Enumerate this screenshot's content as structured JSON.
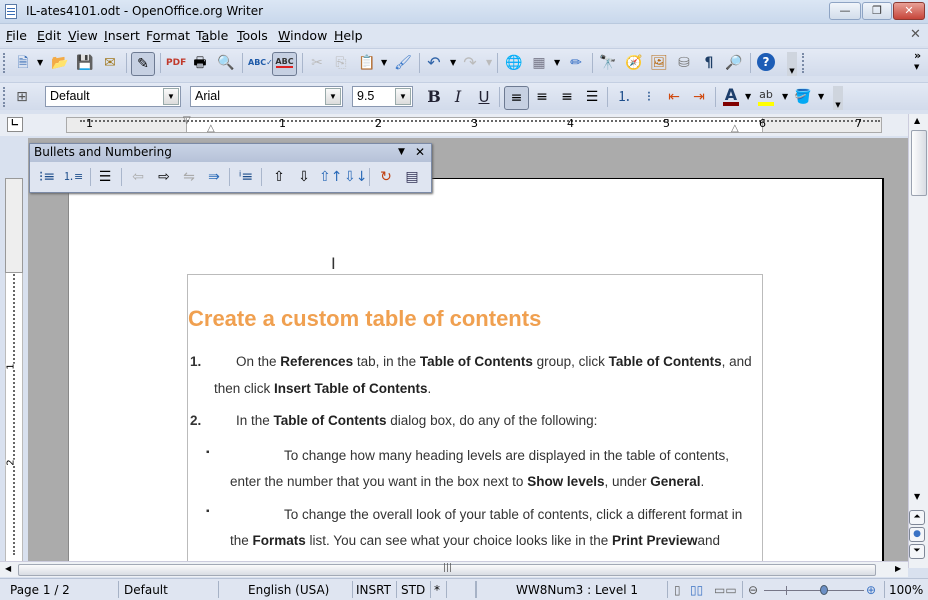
{
  "window": {
    "title": "IL-ates4101.odt - OpenOffice.org Writer",
    "minimize": "—",
    "restore": "❐",
    "close": "✕"
  },
  "menubar": {
    "items": [
      {
        "label": "File",
        "accel": "F",
        "rest": "ile"
      },
      {
        "label": "Edit",
        "accel": "E",
        "rest": "dit"
      },
      {
        "label": "View",
        "accel": "V",
        "rest": "iew"
      },
      {
        "label": "Insert",
        "accel": "I",
        "rest": "nsert"
      },
      {
        "label": "Format",
        "pre": "F",
        "accel": "o",
        "rest": "rmat"
      },
      {
        "label": "Table",
        "pre": "T",
        "accel": "a",
        "rest": "ble"
      },
      {
        "label": "Tools",
        "accel": "T",
        "rest": "ools"
      },
      {
        "label": "Window",
        "accel": "W",
        "rest": "indow"
      },
      {
        "label": "Help",
        "accel": "H",
        "rest": "elp"
      }
    ],
    "close_doc": "✕"
  },
  "standard_toolbar": {
    "icons": [
      "new-document",
      "open",
      "save",
      "email",
      "edit-mode",
      "export-pdf",
      "print",
      "page-preview",
      "spellcheck",
      "autospellcheck",
      "cut",
      "copy",
      "paste",
      "clone-formatting",
      "undo",
      "redo",
      "hyperlink",
      "table",
      "show-draw-functions",
      "find-replace",
      "navigator",
      "gallery",
      "data-sources",
      "nonprinting-characters",
      "zoom",
      "help"
    ],
    "overflow": "»"
  },
  "formatting_toolbar": {
    "style": "Default",
    "font": "Arial",
    "size": "9.5",
    "bold": "B",
    "italic": "I",
    "underline": "U",
    "font_color": "#800000",
    "highlight_color": "#ffff00"
  },
  "ruler": {
    "labels": [
      "1",
      "1",
      "2",
      "3",
      "4",
      "5",
      "6",
      "7"
    ],
    "vlabels": [
      "1",
      "2"
    ]
  },
  "bullets_toolbar": {
    "title": "Bullets and Numbering",
    "icons": [
      "bullets-on-off",
      "numbering-on-off",
      "no-list",
      "promote-one-level",
      "demote-one-level",
      "promote-with-subpoints",
      "demote-with-subpoints",
      "insert-unnumbered-entry",
      "move-up",
      "move-down",
      "move-up-with-subpoints",
      "move-down-with-subpoints",
      "restart-numbering",
      "bullets-and-numbering-dialog"
    ]
  },
  "document": {
    "heading": "Create a custom table of contents",
    "items": [
      {
        "marker": "1.",
        "line1": [
          "On the ",
          "References",
          " tab, in the ",
          "Table of Contents",
          " group, click ",
          "Table of Contents",
          ", and"
        ],
        "line2": [
          "then click ",
          "Insert Table of Contents",
          "."
        ]
      },
      {
        "marker": "2.",
        "line1": [
          "In the ",
          "Table of Contents",
          " dialog box, do any of the following:"
        ]
      }
    ],
    "bullets": [
      {
        "marker": "▪",
        "line1": "To change how many heading levels are displayed in the table of contents,",
        "line2": [
          "enter the number that you want in the box next to ",
          "Show levels",
          ", under ",
          "General",
          "."
        ]
      },
      {
        "marker": "▪",
        "line1": "To change the overall look of your table of contents, click a different format in",
        "line2": [
          "the ",
          "Formats",
          " list. You can see what your choice looks like in the ",
          "Print Preview",
          "and"
        ]
      }
    ]
  },
  "statusbar": {
    "page": "Page 1 / 2",
    "page_style": "Default",
    "language": "English (USA)",
    "insert_mode": "INSRT",
    "selection_mode": "STD",
    "modified": "*",
    "list_style": "WW8Num3 : Level 1",
    "zoom": "100%",
    "zoom_slider_percent": 60
  }
}
